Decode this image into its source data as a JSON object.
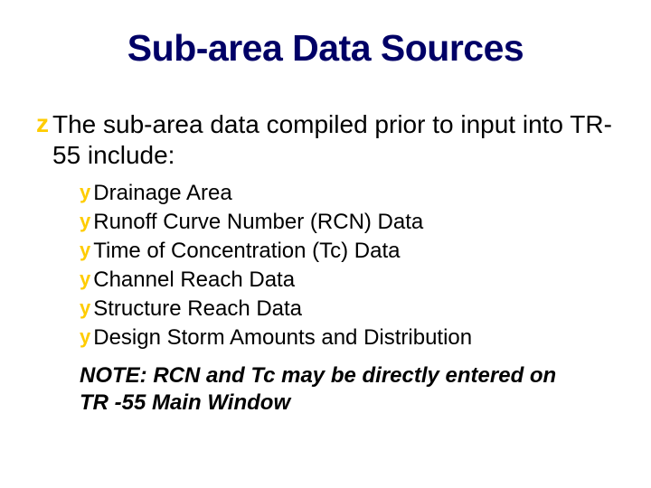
{
  "title": "Sub-area Data Sources",
  "level1_bullet": "z",
  "level1_text": "The sub-area data compiled prior to input into TR-55 include:",
  "sub_bullet": "y",
  "sub_items": [
    "Drainage Area",
    "Runoff Curve Number (RCN)  Data",
    "Time of Concentration (Tc)  Data",
    "Channel Reach Data",
    "Structure Reach Data",
    "Design Storm Amounts and Distribution"
  ],
  "note": "NOTE: RCN and Tc may be directly entered on TR -55 Main Window"
}
